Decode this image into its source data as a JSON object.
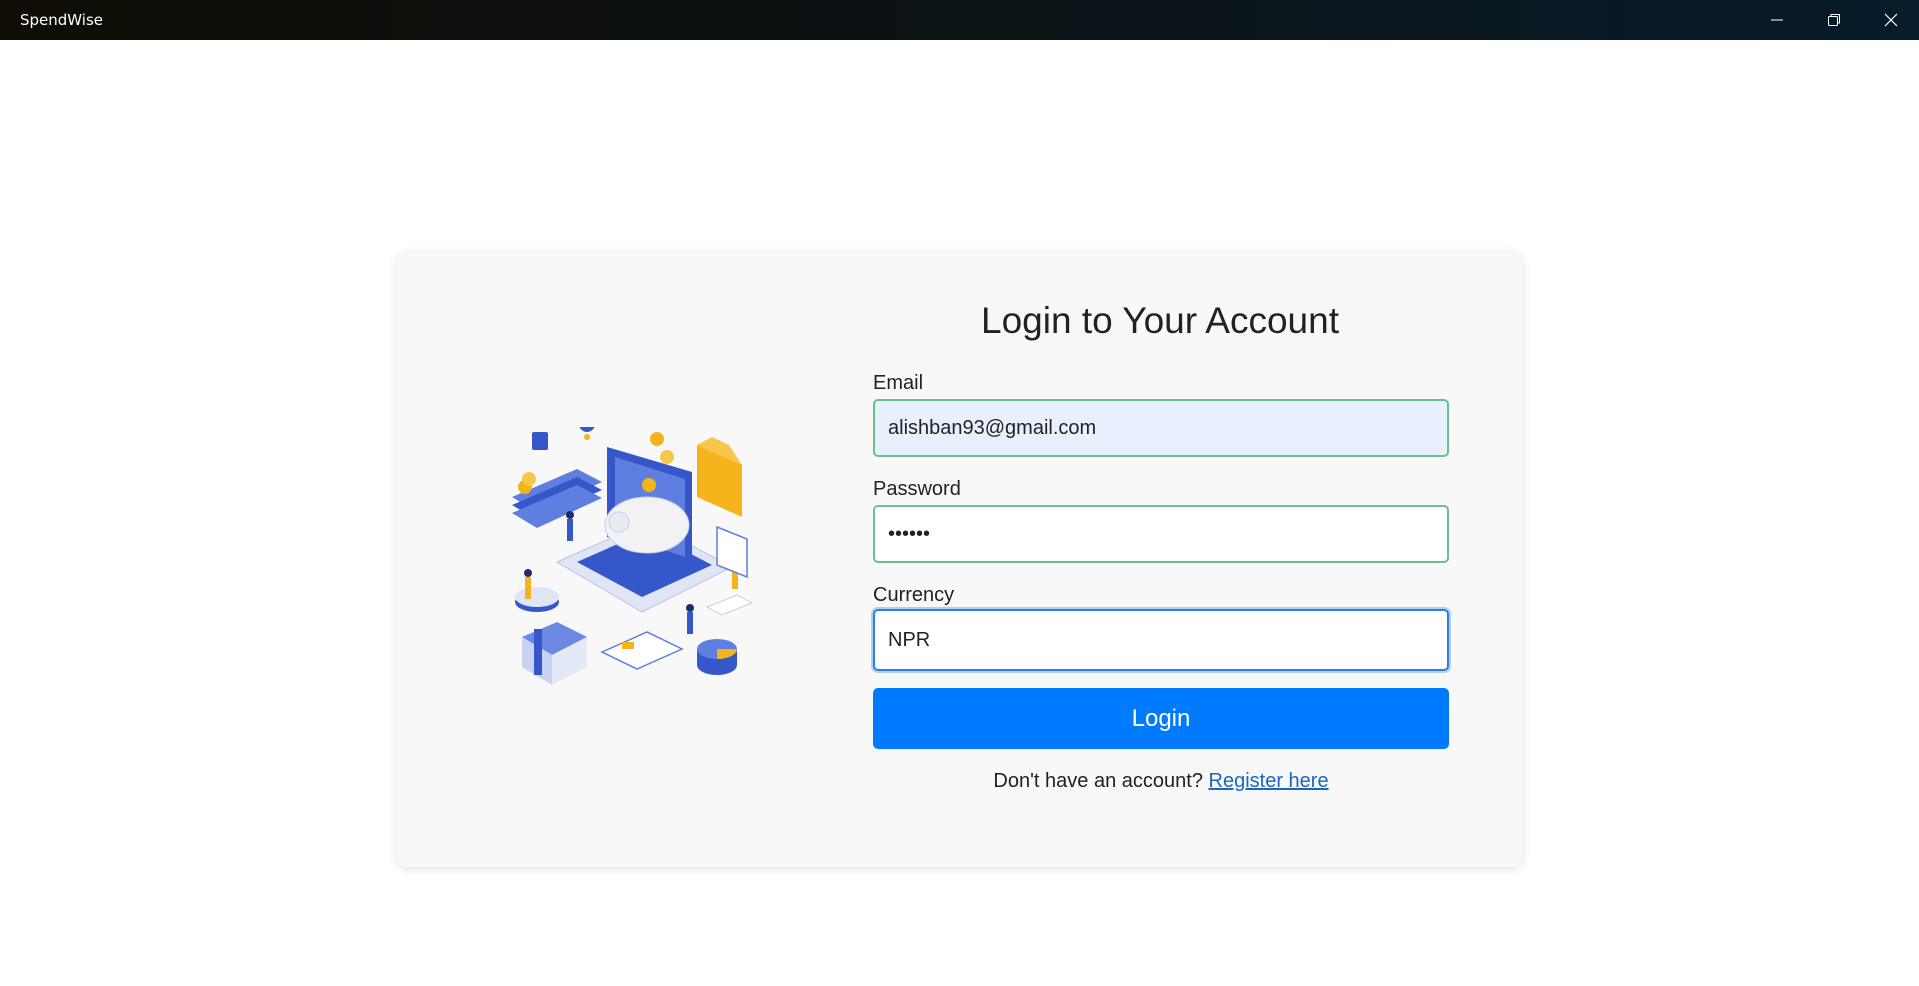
{
  "window": {
    "title": "SpendWise",
    "controls": {
      "minimize_icon": "minimize-icon",
      "maximize_icon": "restore-icon",
      "close_icon": "close-icon"
    }
  },
  "login": {
    "heading": "Login to Your Account",
    "email": {
      "label": "Email",
      "value": "alishban93@gmail.com"
    },
    "password": {
      "label": "Password",
      "value": "••••••"
    },
    "currency": {
      "label": "Currency",
      "value": "NPR"
    },
    "submit_label": "Login",
    "register_prompt": "Don't have an account?",
    "register_link": "Register here"
  },
  "colors": {
    "primary": "#007bff",
    "valid_border": "#6cc08a",
    "focus_border": "#2f7fe3",
    "link": "#1a66c2",
    "illustration_blue": "#3557c9",
    "illustration_gold": "#f5b41b"
  },
  "illustration_icon": "finance-isometric-illustration"
}
